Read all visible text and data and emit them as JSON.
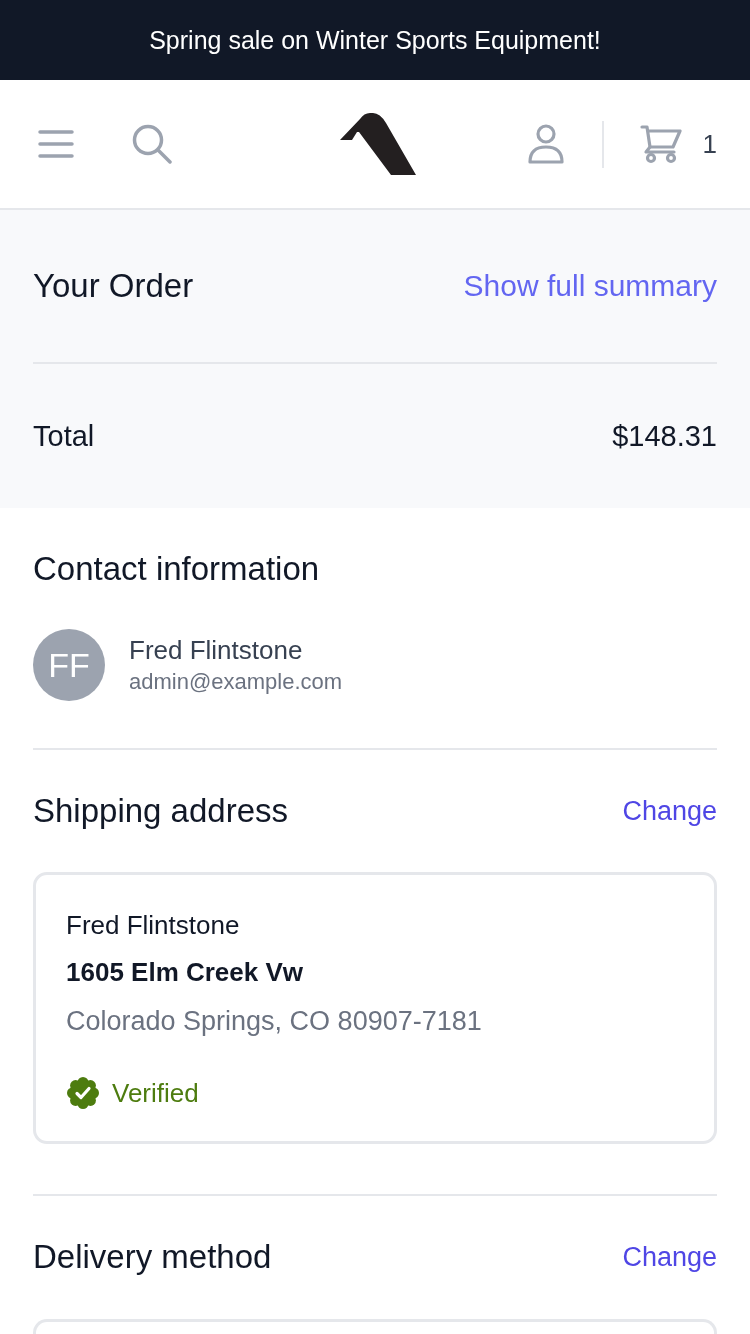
{
  "banner": {
    "text": "Spring sale on Winter Sports Equipment!"
  },
  "header": {
    "cart_count": "1"
  },
  "order_summary": {
    "title": "Your Order",
    "link": "Show full summary",
    "total_label": "Total",
    "total_value": "$148.31"
  },
  "contact": {
    "title": "Contact information",
    "avatar_initials": "FF",
    "name": "Fred Flintstone",
    "email": "admin@example.com"
  },
  "shipping": {
    "title": "Shipping address",
    "action": "Change",
    "address": {
      "name": "Fred Flintstone",
      "street": "1605 Elm Creek Vw",
      "city_line": "Colorado Springs, CO 80907-7181",
      "verified": true,
      "verified_label": "Verified"
    }
  },
  "delivery": {
    "title": "Delivery method",
    "action": "Change"
  }
}
